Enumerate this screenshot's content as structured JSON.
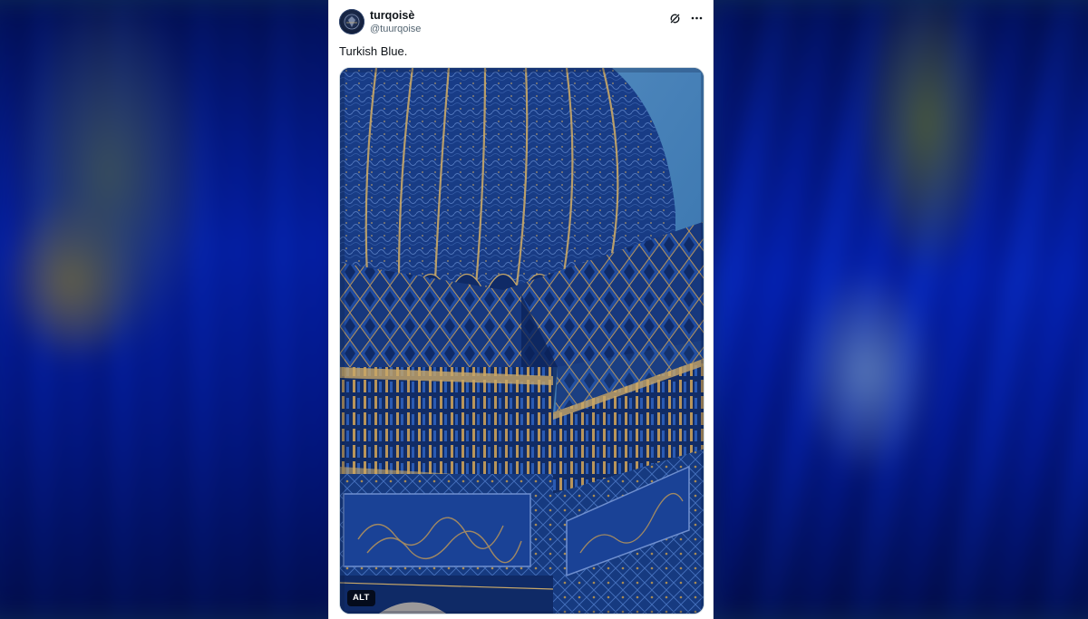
{
  "post": {
    "display_name": "turqoisè",
    "handle": "@tuurqoise",
    "text": "Turkish Blue.",
    "alt_label": "ALT"
  },
  "icons": {
    "avatar": "avatar-image",
    "header_left": "grok-icon",
    "header_right": "more-icon"
  },
  "colors": {
    "accent_blue": "#1a3f8f",
    "gold": "#b9955a",
    "text_primary": "#0f1419",
    "text_secondary": "#536471"
  }
}
